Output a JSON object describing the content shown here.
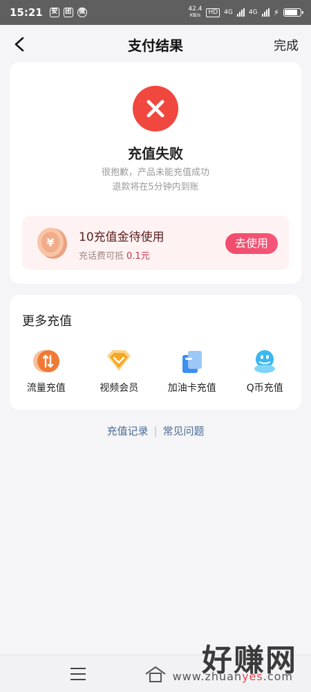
{
  "status_bar": {
    "time": "15:21",
    "app_icons": [
      "安",
      "团",
      "微"
    ],
    "net_speed_top": "42.4",
    "net_speed_unit": "KB/s",
    "sim1": "HD",
    "net1": "4G",
    "net2": "4G"
  },
  "header": {
    "title": "支付结果",
    "done_label": "完成"
  },
  "result": {
    "status_icon": "close-icon",
    "title": "充值失败",
    "line1": "很抱歉，产品未能充值成功",
    "line2": "退款将在5分钟内到账"
  },
  "coupon": {
    "title": "10充值金待使用",
    "desc": "充话费可抵",
    "amount": "0.1元",
    "button": "去使用",
    "accent": "#f04c6d"
  },
  "more": {
    "title": "更多充值",
    "items": [
      {
        "label": "流量充值",
        "icon": "data-traffic-icon"
      },
      {
        "label": "视频会员",
        "icon": "video-vip-icon"
      },
      {
        "label": "加油卡充值",
        "icon": "fuel-card-icon"
      },
      {
        "label": "Q币充值",
        "icon": "qq-coin-icon"
      }
    ]
  },
  "links": {
    "records": "充值记录",
    "separator": "|",
    "faq": "常见问题"
  },
  "watermark": {
    "text": "好赚网",
    "url_prefix": "www.zhuan",
    "url_highlight": "yes",
    "url_suffix": ".com"
  }
}
